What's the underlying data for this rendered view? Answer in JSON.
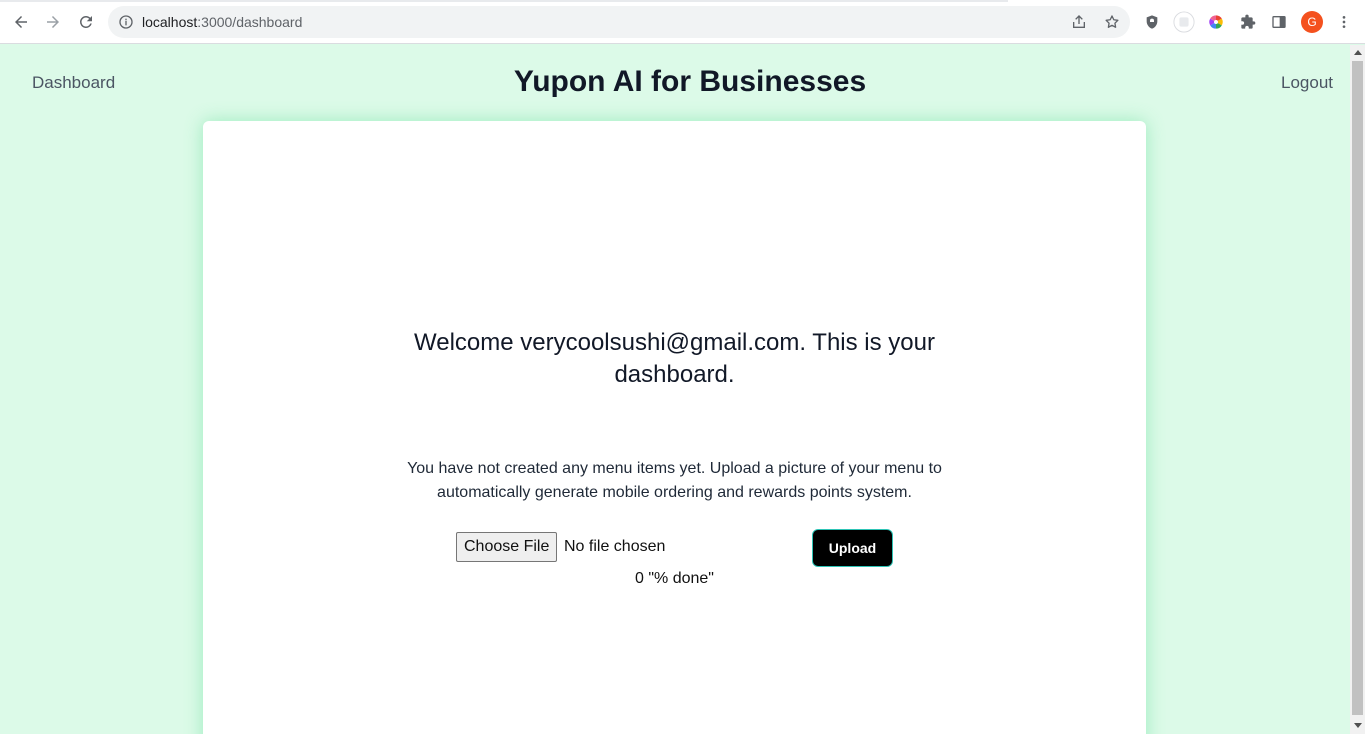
{
  "browser": {
    "url_host": "localhost",
    "url_path": ":3000/dashboard",
    "profile_initial": "G",
    "icons": [
      "back-icon",
      "forward-icon",
      "reload-icon",
      "info-icon",
      "share-icon",
      "star-icon",
      "shield-extension-icon",
      "extension-icon",
      "color-wheel-extension-icon",
      "puzzle-icon",
      "side-panel-icon",
      "more-vert-icon"
    ]
  },
  "nav": {
    "left_link": "Dashboard",
    "brand": "Yupon AI for Businesses",
    "right_link": "Logout"
  },
  "dashboard": {
    "welcome": "Welcome verycoolsushi@gmail.com. This is your dashboard.",
    "notice": "You have not created any menu items yet. Upload a picture of your menu to automatically generate mobile ordering and rewards points system.",
    "file_button_label": "Choose File",
    "file_status": "No file chosen",
    "upload_label": "Upload",
    "progress_text": "0 \"% done\""
  },
  "colors": {
    "page_bg": "#dcfae8",
    "card_bg": "#ffffff",
    "upload_bg": "#000000",
    "upload_border": "#2ec4b6"
  }
}
